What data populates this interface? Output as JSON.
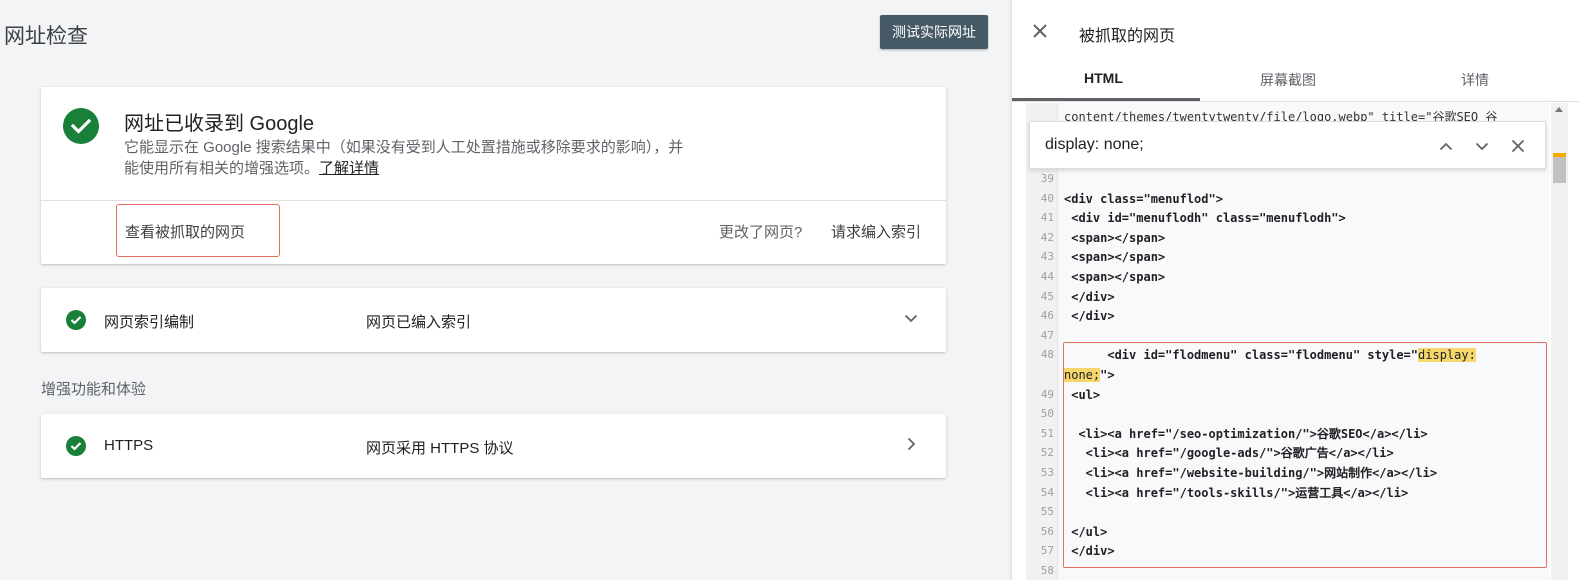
{
  "page_title": "网址检查",
  "test_button": "测试实际网址",
  "main_card": {
    "title": "网址已收录到 Google",
    "description": "它能显示在 Google 搜索结果中（如果没有受到人工处置措施或移除要求的影响），并能使用所有相关的增强选项。",
    "learn_more": "了解详情",
    "view_crawled": "查看被抓取的网页",
    "changed_question": "更改了网页?",
    "request_indexing": "请求编入索引"
  },
  "index_row": {
    "label": "网页索引编制",
    "value": "网页已编入索引"
  },
  "section_label": "增强功能和体验",
  "https_row": {
    "label": "HTTPS",
    "value": "网页采用 HTTPS 协议"
  },
  "panel": {
    "title": "被抓取的网页",
    "tabs": [
      "HTML",
      "屏幕截图",
      "详情"
    ],
    "active_tab": "HTML",
    "search_value": "display: none;",
    "code_top": "content/themes/twentytwenty/file/logo.webp\" title=\"谷歌SEO  谷",
    "code_lines": [
      {
        "n": "39",
        "code": ""
      },
      {
        "n": "40",
        "code": "<div class=\"menuflod\">"
      },
      {
        "n": "41",
        "code": " <div id=\"menuflodh\" class=\"menuflodh\">"
      },
      {
        "n": "42",
        "code": " <span></span>"
      },
      {
        "n": "43",
        "code": " <span></span>"
      },
      {
        "n": "44",
        "code": " <span></span>"
      },
      {
        "n": "45",
        "code": " </div>"
      },
      {
        "n": "46",
        "code": " </div>"
      },
      {
        "n": "47",
        "code": ""
      },
      {
        "n": "48",
        "code": "      <div id=\"flodmenu\" class=\"flodmenu\" style=\"display:"
      },
      {
        "n": "",
        "code": "none;\">"
      },
      {
        "n": "49",
        "code": " <ul>"
      },
      {
        "n": "50",
        "code": ""
      },
      {
        "n": "51",
        "code": "  <li><a href=\"/seo-optimization/\">谷歌SEO</a></li>"
      },
      {
        "n": "52",
        "code": "   <li><a href=\"/google-ads/\">谷歌广告</a></li>"
      },
      {
        "n": "53",
        "code": "   <li><a href=\"/website-building/\">网站制作</a></li>"
      },
      {
        "n": "54",
        "code": "   <li><a href=\"/tools-skills/\">运营工具</a></li>"
      },
      {
        "n": "55",
        "code": ""
      },
      {
        "n": "56",
        "code": " </ul>"
      },
      {
        "n": "57",
        "code": " </div>"
      },
      {
        "n": "58",
        "code": ""
      }
    ]
  },
  "colors": {
    "success_green": "#188038",
    "highlight_yellow": "#f6d76b",
    "annotation_red": "#e0705f",
    "button_dark": "#455a64"
  }
}
